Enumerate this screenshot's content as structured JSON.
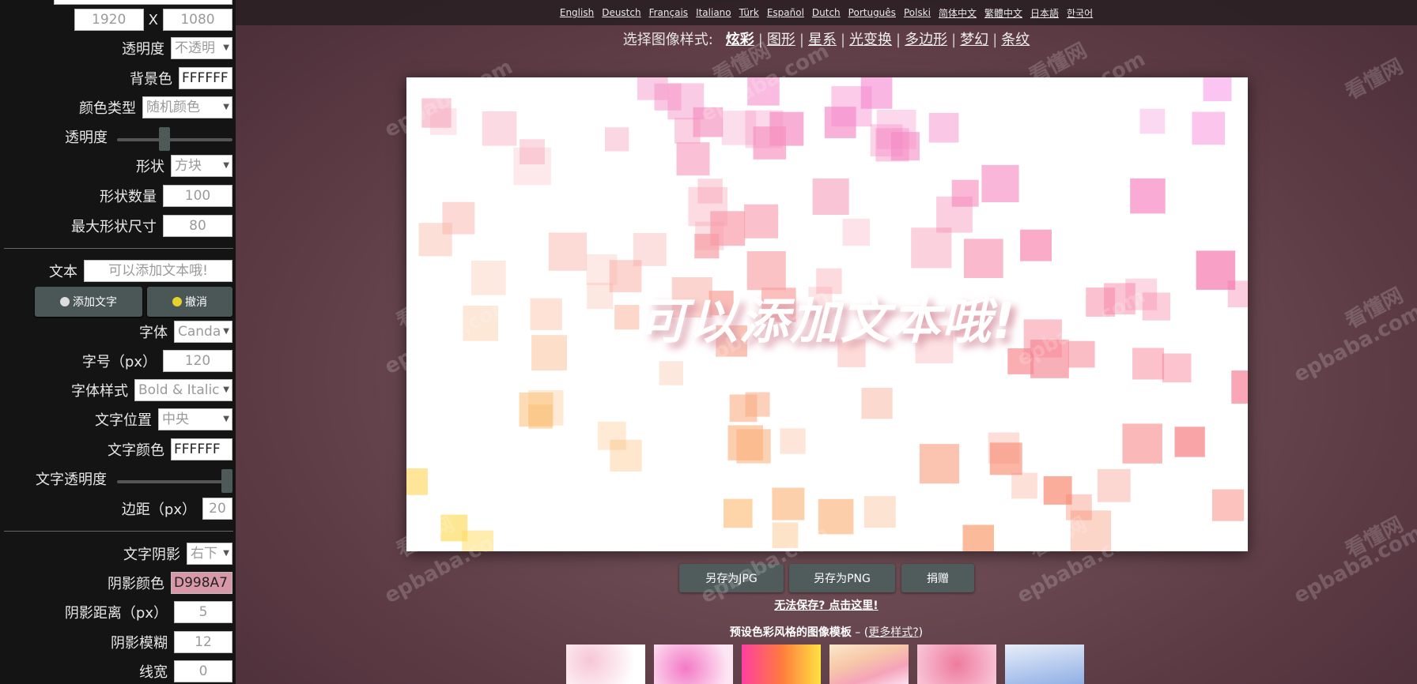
{
  "sidebar": {
    "width_value": "1920",
    "height_value": "1080",
    "size_sep": "X",
    "opacity_label": "透明度",
    "opacity_value": "不透明",
    "bg_label": "背景色",
    "bg_value": "FFFFFF",
    "color_type_label": "颜色类型",
    "color_type_value": "随机颜色",
    "shape_opacity_label": "透明度",
    "shape_opacity_level": 0.4,
    "shape_label": "形状",
    "shape_value": "方块",
    "shape_count_label": "形状数量",
    "shape_count_value": "100",
    "max_size_label": "最大形状尺寸",
    "max_size_value": "80",
    "text_label": "文本",
    "text_placeholder": "可以添加文本哦!",
    "add_text_button": "添加文字",
    "undo_button": "撤消",
    "font_label": "字体",
    "font_value": "Canda",
    "font_size_label": "字号（px）",
    "font_size_value": "120",
    "font_style_label": "字体样式",
    "font_style_value": "Bold & Italic",
    "text_pos_label": "文字位置",
    "text_pos_value": "中央",
    "text_color_label": "文字颜色",
    "text_color_value": "FFFFFF",
    "text_opacity_label": "文字透明度",
    "text_opacity_level": 1.0,
    "margin_label": "边距（px）",
    "margin_value": "20",
    "shadow_label": "文字阴影",
    "shadow_value": "右下",
    "shadow_color_label": "阴影颜色",
    "shadow_color_value": "D998A7",
    "shadow_dist_label": "阴影距离（px）",
    "shadow_dist_value": "5",
    "shadow_blur_label": "阴影模糊",
    "shadow_blur_value": "12",
    "line_width_label": "线宽",
    "line_width_value": "0"
  },
  "languages": [
    "English",
    "Deustch",
    "Français",
    "Italiano",
    "Türk",
    "Español",
    "Dutch",
    "Português",
    "Polski",
    "简体中文",
    "繁體中文",
    "日本語",
    "한국어"
  ],
  "style_bar": {
    "prompt": "选择图像样式:",
    "styles": [
      "炫彩",
      "图形",
      "星系",
      "光变换",
      "多边形",
      "梦幻",
      "条纹"
    ],
    "active": "炫彩"
  },
  "canvas": {
    "text": "可以添加文本哦!"
  },
  "actions": {
    "save_jpg": "另存为JPG",
    "save_png": "另存为PNG",
    "donate": "捐赠",
    "cant_save": "无法保存? 点击这里!",
    "presets_title": "预设色彩风格的图像模板",
    "presets_sep": " – (",
    "more_styles": "更多样式?",
    "presets_close": ")"
  },
  "watermark": {
    "text1": "epbaba.com",
    "text2": "看懂网"
  },
  "colors": {
    "sidebar_bg": "#141414",
    "button_bg": "#4a5756",
    "shadow": "#D998A7"
  }
}
